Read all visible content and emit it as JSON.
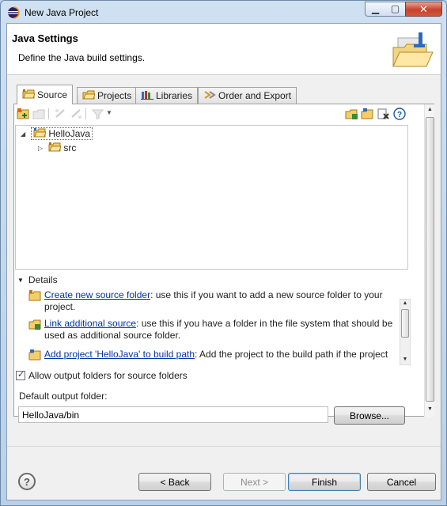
{
  "window": {
    "title": "New Java Project",
    "icon": "eclipse-icon",
    "controls": {
      "minimize": "minimize-icon",
      "maximize": "maximize-icon",
      "close": "close-icon"
    }
  },
  "header": {
    "title": "Java Settings",
    "description": "Define the Java build settings.",
    "banner_icon": "new-java-project-wizard-icon"
  },
  "tabs": [
    {
      "label": "Source",
      "icon": "source-folder-icon",
      "active": true
    },
    {
      "label": "Projects",
      "icon": "projects-icon",
      "active": false
    },
    {
      "label": "Libraries",
      "icon": "libraries-icon",
      "active": false
    },
    {
      "label": "Order and Export",
      "icon": "order-export-icon",
      "active": false
    }
  ],
  "toolbar": {
    "left": [
      "add-source-folder-icon",
      "edit-source-folder-icon",
      "link-source-icon",
      "unlink-source-icon",
      "filter-icon",
      "dropdown-arrow-icon"
    ],
    "right": [
      "link-additional-source-icon",
      "add-project-icon",
      "remove-icon",
      "help-icon"
    ]
  },
  "tree": {
    "project": {
      "label": "HelloJava",
      "expanded": true
    },
    "children": [
      {
        "label": "src",
        "expanded": false
      }
    ]
  },
  "details": {
    "heading": "Details",
    "items": [
      {
        "link": "Create new source folder",
        "text": ": use this if you want to add a new source folder to your project.",
        "icon": "new-source-folder-icon"
      },
      {
        "link": "Link additional source",
        "text": ": use this if you have a folder in the file system that should be used as additional source folder.",
        "icon": "link-source-icon"
      },
      {
        "link": "Add project 'HelloJava' to build path",
        "text": ": Add the project to the build path if the project",
        "icon": "add-to-build-path-icon"
      }
    ]
  },
  "allow_output_folders": {
    "label": "Allow output folders for source folders",
    "checked": true
  },
  "output_folder": {
    "label": "Default output folder:",
    "value": "HelloJava/bin"
  },
  "buttons": {
    "browse": "Browse...",
    "back": "< Back",
    "next": "Next >",
    "finish": "Finish",
    "cancel": "Cancel"
  }
}
